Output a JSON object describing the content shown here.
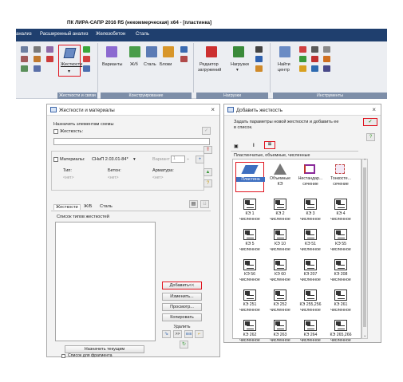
{
  "window_title": "ПК ЛИРА-САПР  2016 R5 (некоммерческая) x64 - [пластинка]",
  "menu": [
    "анализ",
    "Расширенный анализ",
    "Железобетон",
    "Сталь"
  ],
  "ribbon": {
    "stiffness_button": "Жесткости",
    "variants": "Варианты",
    "kzh": "Ж/б",
    "steel": "Сталь",
    "blocks": "Блоки",
    "load_editor_1": "Редактор",
    "load_editor_2": "загружений",
    "loads": "Нагрузки",
    "find_1": "Найти",
    "find_2": "центр",
    "groups": [
      "Жесткости и связи",
      "Конструирование",
      "Нагрузки",
      "Инструменты"
    ]
  },
  "left_dialog": {
    "title": "Жесткости и материалы",
    "assign_label": "Назначить элементам схемы",
    "stiffness_label": "Жесткость:",
    "materials_label": "Материалы:",
    "materials_value": "СНиП 2.03.01-84*",
    "variant_label": "Вариант",
    "variant_value": "1",
    "col_type": "Тип:",
    "col_concrete": "Бетон:",
    "col_rebar": "Арматура:",
    "col_empty": "<нет>",
    "tabs": [
      "Жесткости",
      "Ж/Б",
      "Сталь"
    ],
    "list_label": "Список типов жесткостей",
    "add_button": "Добавить<<",
    "edit_button": "Изменить...",
    "view_button": "Просмотр...",
    "copy_button": "Копировать",
    "delete_button": "Удалить",
    "assign_current": "Назначить текущим",
    "fragment_label": "Список для фрагмента",
    "small_btn_1": ">>",
    "small_btn_2": "888"
  },
  "right_dialog": {
    "title": "Добавить жесткость",
    "hint_1": "Задать параметры новой жесткости и добавить ее",
    "hint_2": "в список.",
    "tab_icons": [
      "▣",
      "I",
      "⊠"
    ],
    "category_label": "Пластинчатые, объемные, численные",
    "top_items": [
      {
        "n1": "Пластина",
        "n2": ""
      },
      {
        "n1": "Объемные",
        "n2": "КЭ"
      },
      {
        "n1": "Нестандар...",
        "n2": "сечение"
      },
      {
        "n1": "Тонкосте...",
        "n2": "сечение"
      }
    ],
    "grid_items": [
      {
        "n1": "КЭ 1",
        "n2": "численное"
      },
      {
        "n1": "КЭ 2",
        "n2": "численное"
      },
      {
        "n1": "КЭ 3",
        "n2": "численное"
      },
      {
        "n1": "КЭ 4",
        "n2": "численное"
      },
      {
        "n1": "КЭ 5",
        "n2": "численное"
      },
      {
        "n1": "КЭ 10",
        "n2": "численное"
      },
      {
        "n1": "КЭ 51",
        "n2": "численное"
      },
      {
        "n1": "КЭ 55",
        "n2": "численное"
      },
      {
        "n1": "КЭ 56",
        "n2": "численное"
      },
      {
        "n1": "КЭ 60",
        "n2": "численное"
      },
      {
        "n1": "КЭ 207",
        "n2": "численное"
      },
      {
        "n1": "КЭ 208",
        "n2": "численное"
      },
      {
        "n1": "КЭ 251",
        "n2": "численное"
      },
      {
        "n1": "КЭ 252",
        "n2": "численное"
      },
      {
        "n1": "КЭ 255,256",
        "n2": "численное"
      },
      {
        "n1": "КЭ 261",
        "n2": "численное"
      },
      {
        "n1": "КЭ 262",
        "n2": "численное"
      },
      {
        "n1": "КЭ 263",
        "n2": "численное"
      },
      {
        "n1": "КЭ 264",
        "n2": "численное"
      },
      {
        "n1": "КЭ 265,266",
        "n2": "численное"
      }
    ],
    "help": "?",
    "ok": "✓"
  },
  "icons": [
    "stiffness-icon",
    "variants-icon",
    "rc-icon",
    "steel-icon",
    "blocks-icon",
    "load-editor-icon",
    "loads-icon",
    "find-center-icon",
    "close-icon",
    "plate-icon",
    "solid-icon",
    "nonstandard-section-icon",
    "thin-walled-section-icon",
    "numeric-fe-icon",
    "check-icon",
    "help-icon"
  ],
  "colors": {
    "highlight": "#e0141f",
    "menu_bar": "#1f3f6e",
    "group_label": "#7d8ea8",
    "ok_green": "#3a9a2a"
  }
}
